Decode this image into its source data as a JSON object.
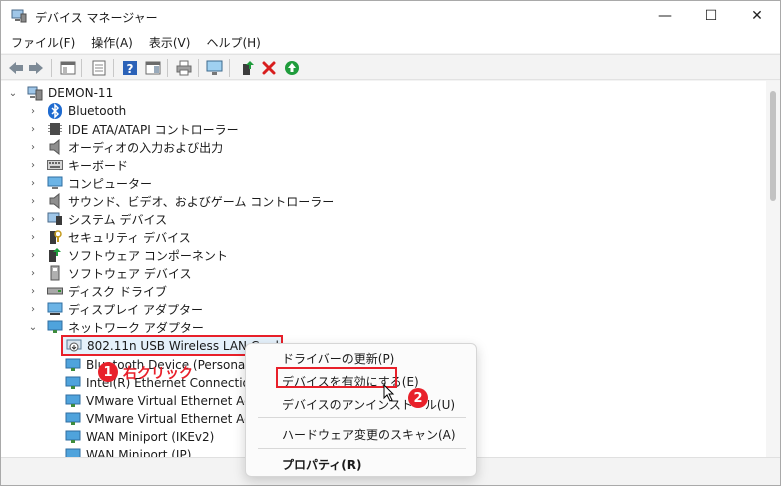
{
  "window": {
    "title": "デバイス マネージャー",
    "min_glyph": "—",
    "max_glyph": "☐",
    "close_glyph": "✕"
  },
  "menu": [
    "ファイル(F)",
    "操作(A)",
    "表示(V)",
    "ヘルプ(H)"
  ],
  "tree": {
    "root": "DEMON-11",
    "categories": [
      {
        "label": "Bluetooth",
        "icon": "bluetooth-icon"
      },
      {
        "label": "IDE ATA/ATAPI コントローラー",
        "icon": "ide-controller-icon"
      },
      {
        "label": "オーディオの入力および出力",
        "icon": "speaker-icon"
      },
      {
        "label": "キーボード",
        "icon": "keyboard-icon"
      },
      {
        "label": "コンピューター",
        "icon": "computer-icon"
      },
      {
        "label": "サウンド、ビデオ、およびゲーム コントローラー",
        "icon": "speaker-icon"
      },
      {
        "label": "システム デバイス",
        "icon": "system-device-icon"
      },
      {
        "label": "セキュリティ デバイス",
        "icon": "security-device-icon"
      },
      {
        "label": "ソフトウェア コンポーネント",
        "icon": "software-component-icon"
      },
      {
        "label": "ソフトウェア デバイス",
        "icon": "software-device-icon"
      },
      {
        "label": "ディスク ドライブ",
        "icon": "disk-drive-icon"
      },
      {
        "label": "ディスプレイ アダプター",
        "icon": "display-adapter-icon"
      },
      {
        "label": "ネットワーク アダプター",
        "icon": "network-adapter-icon"
      }
    ],
    "network_children": [
      "802.11n USB Wireless LAN Card",
      "Bluetooth Device (Personal Area",
      "Intel(R) Ethernet Connection (1",
      "VMware Virtual Ethernet Adapt",
      "VMware Virtual Ethernet Adapt",
      "WAN Miniport (IKEv2)",
      "WAN Miniport (IP)"
    ]
  },
  "context_menu": {
    "update_driver": "ドライバーの更新(P)",
    "enable_device": "デバイスを有効にする(E)",
    "uninstall_device": "デバイスのアンインストール(U)",
    "scan_hardware": "ハードウェア変更のスキャン(A)",
    "properties": "プロパティ(R)"
  },
  "annotations": {
    "step1_number": "1",
    "step1_text": "右クリック",
    "step2_number": "2"
  },
  "colors": {
    "accent_red": "#e8202a",
    "selection_bg": "#e5f1fb",
    "enable_green": "#1f9c3c"
  }
}
